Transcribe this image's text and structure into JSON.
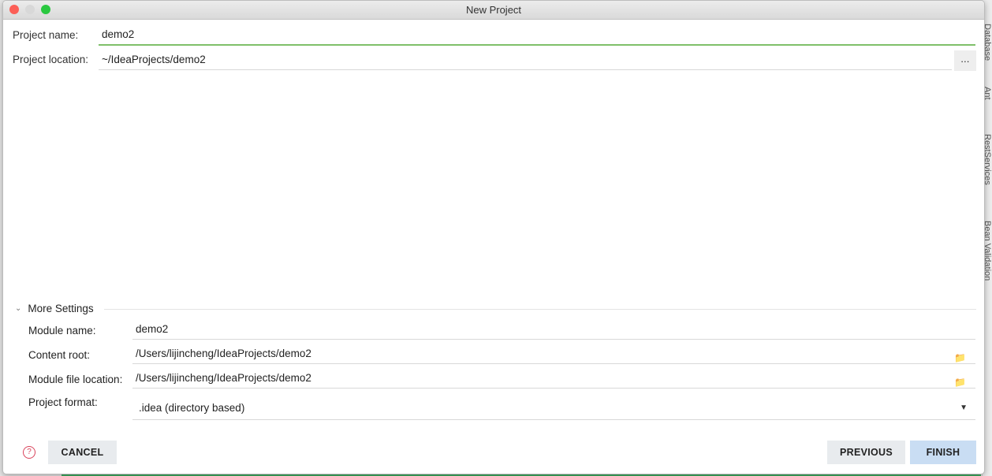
{
  "window": {
    "title": "New Project"
  },
  "project": {
    "name_label": "Project name:",
    "name_value": "demo2",
    "location_label": "Project location:",
    "location_value": "~/IdeaProjects/demo2",
    "browse_label": "..."
  },
  "more_settings": {
    "title": "More Settings",
    "module_name_label": "Module name:",
    "module_name_value": "demo2",
    "content_root_label": "Content root:",
    "content_root_value": "/Users/lijincheng/IdeaProjects/demo2",
    "module_file_label": "Module file location:",
    "module_file_value": "/Users/lijincheng/IdeaProjects/demo2",
    "format_label": "Project format:",
    "format_value": ".idea (directory based)"
  },
  "buttons": {
    "cancel": "CANCEL",
    "previous": "PREVIOUS",
    "finish": "FINISH"
  },
  "side_tools": [
    "Database",
    "Ant",
    "RestServices",
    "Bean Validation"
  ],
  "colors": {
    "focus": "#7fbf6a",
    "finish": "#c9ddf3",
    "button": "#e8ebee"
  }
}
